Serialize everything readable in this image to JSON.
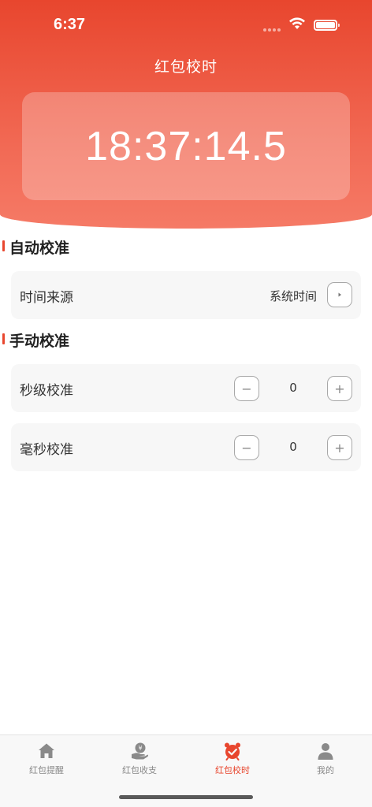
{
  "status_bar": {
    "time": "6:37"
  },
  "header": {
    "title": "红包校时",
    "clock": "18:37:14.5"
  },
  "auto_section": {
    "title": "自动校准",
    "source_label": "时间来源",
    "source_value": "系统时间"
  },
  "manual_section": {
    "title": "手动校准",
    "rows": [
      {
        "label": "秒级校准",
        "value": "0",
        "minus": "−",
        "plus": "+"
      },
      {
        "label": "毫秒校准",
        "value": "0",
        "minus": "−",
        "plus": "+"
      }
    ]
  },
  "tabbar": {
    "tabs": [
      {
        "label": "红包提醒",
        "icon": "home-icon"
      },
      {
        "label": "红包收支",
        "icon": "money-hand-icon"
      },
      {
        "label": "红包校时",
        "icon": "alarm-clock-icon",
        "active": true
      },
      {
        "label": "我的",
        "icon": "person-icon"
      }
    ]
  },
  "colors": {
    "accent": "#e8462e",
    "header_bottom": "#f57a66",
    "card_bg": "#f7f7f7",
    "tab_inactive": "#888888"
  }
}
